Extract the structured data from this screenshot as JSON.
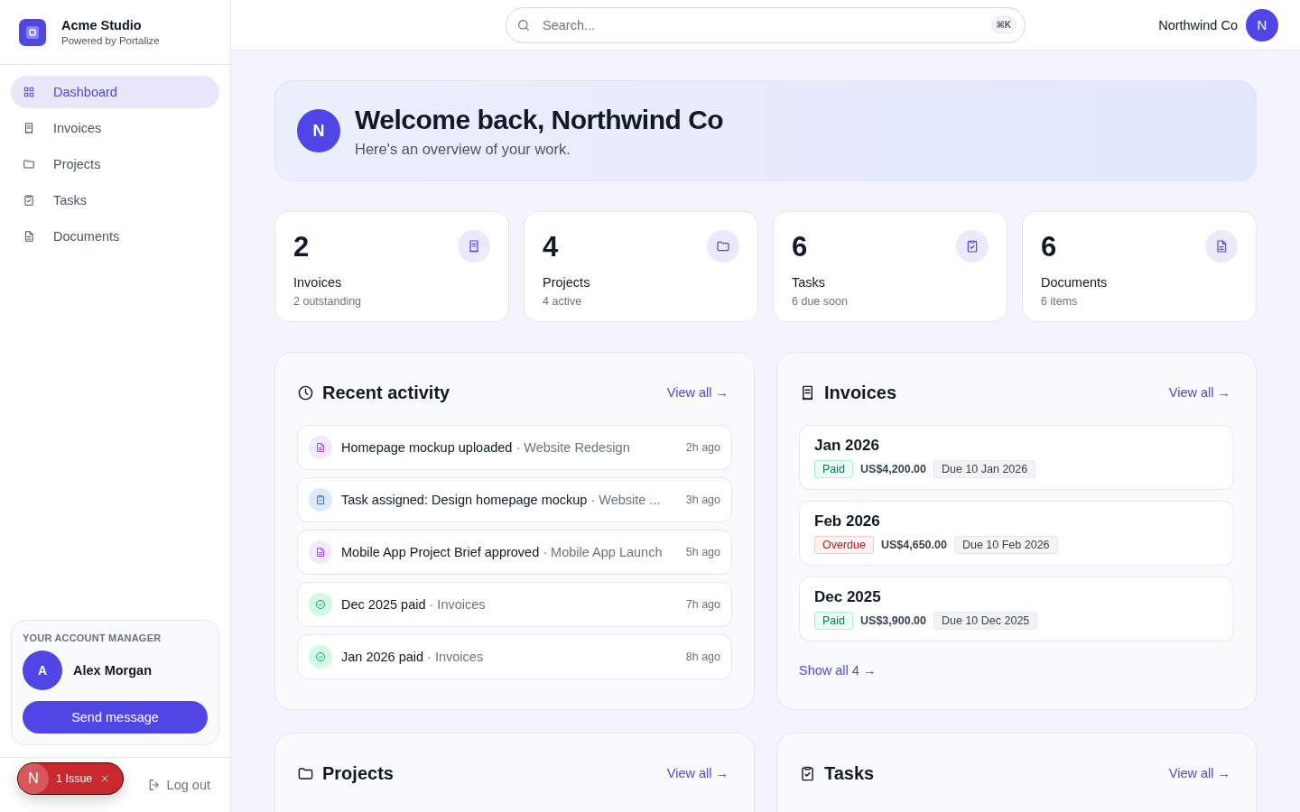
{
  "brand": {
    "name": "Acme Studio",
    "tagline": "Powered by Portalize"
  },
  "nav": [
    {
      "label": "Dashboard",
      "kind": "dashboard",
      "selected": true
    },
    {
      "label": "Invoices",
      "kind": "invoice",
      "selected": false
    },
    {
      "label": "Projects",
      "kind": "project",
      "selected": false
    },
    {
      "label": "Tasks",
      "kind": "task",
      "selected": false
    },
    {
      "label": "Documents",
      "kind": "document",
      "selected": false
    }
  ],
  "account_manager": {
    "heading": "YOUR ACCOUNT MANAGER",
    "initial": "A",
    "name": "Alex Morgan",
    "button": "Send message"
  },
  "logout": "Log out",
  "dev_badge": {
    "letter": "N",
    "label": "1 Issue"
  },
  "search": {
    "placeholder": "Search...",
    "shortcut": "⌘K"
  },
  "user": {
    "name": "Northwind Co",
    "initial": "N"
  },
  "welcome": {
    "initial": "N",
    "title": "Welcome back, Northwind Co",
    "subtitle": "Here's an overview of your work."
  },
  "stats": [
    {
      "value": "2",
      "label": "Invoices",
      "detail": "2 outstanding",
      "kind": "invoice"
    },
    {
      "value": "4",
      "label": "Projects",
      "detail": "4 active",
      "kind": "project"
    },
    {
      "value": "6",
      "label": "Tasks",
      "detail": "6 due soon",
      "kind": "task"
    },
    {
      "value": "6",
      "label": "Documents",
      "detail": "6 items",
      "kind": "document"
    }
  ],
  "activity": {
    "title": "Recent activity",
    "link": "View all →",
    "items": [
      {
        "kind": "document",
        "title": "Homepage mockup uploaded",
        "context": "· Website Redesign",
        "time": "2h ago"
      },
      {
        "kind": "task",
        "title": "Task assigned: Design homepage mockup",
        "context": "· Website ...",
        "time": "3h ago"
      },
      {
        "kind": "document",
        "title": "Mobile App Project Brief approved",
        "context": "· Mobile App Launch",
        "time": "5h ago"
      },
      {
        "kind": "paid",
        "title": "Dec 2025 paid",
        "context": "· Invoices",
        "time": "7h ago"
      },
      {
        "kind": "paid",
        "title": "Jan 2026 paid",
        "context": "· Invoices",
        "time": "8h ago"
      }
    ]
  },
  "invoices": {
    "title": "Invoices",
    "link": "View all →",
    "items": [
      {
        "period": "Jan 2026",
        "status": "Paid",
        "kind": "paid",
        "amount": "US$4,200.00",
        "due": "Due 10 Jan 2026"
      },
      {
        "period": "Feb 2026",
        "status": "Overdue",
        "kind": "overdue",
        "amount": "US$4,650.00",
        "due": "Due 10 Feb 2026"
      },
      {
        "period": "Dec 2025",
        "status": "Paid",
        "kind": "paid",
        "amount": "US$3,900.00",
        "due": "Due 10 Dec 2025"
      }
    ],
    "show_all": "Show all 4 →"
  },
  "projects": {
    "title": "Projects",
    "link": "View all →"
  },
  "tasks": {
    "title": "Tasks",
    "link": "View all →"
  }
}
